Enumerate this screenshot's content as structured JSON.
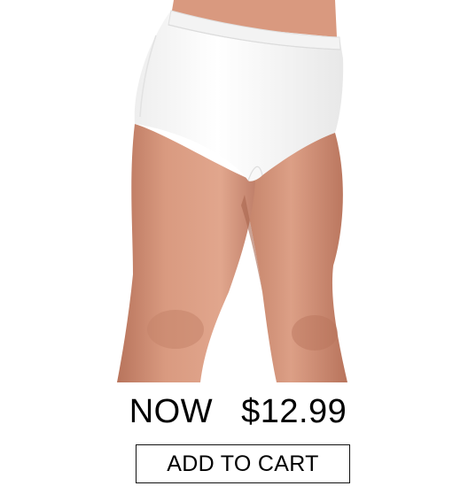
{
  "product": {
    "image_alt": "White high-waist cotton brief worn by model",
    "image_colors": {
      "garment": "#ffffff",
      "skin": "#d99a80",
      "skin_shadow": "#b8745c"
    }
  },
  "pricing": {
    "prefix": "NOW",
    "price": "$12.99"
  },
  "actions": {
    "add_to_cart_label": "ADD TO CART"
  }
}
